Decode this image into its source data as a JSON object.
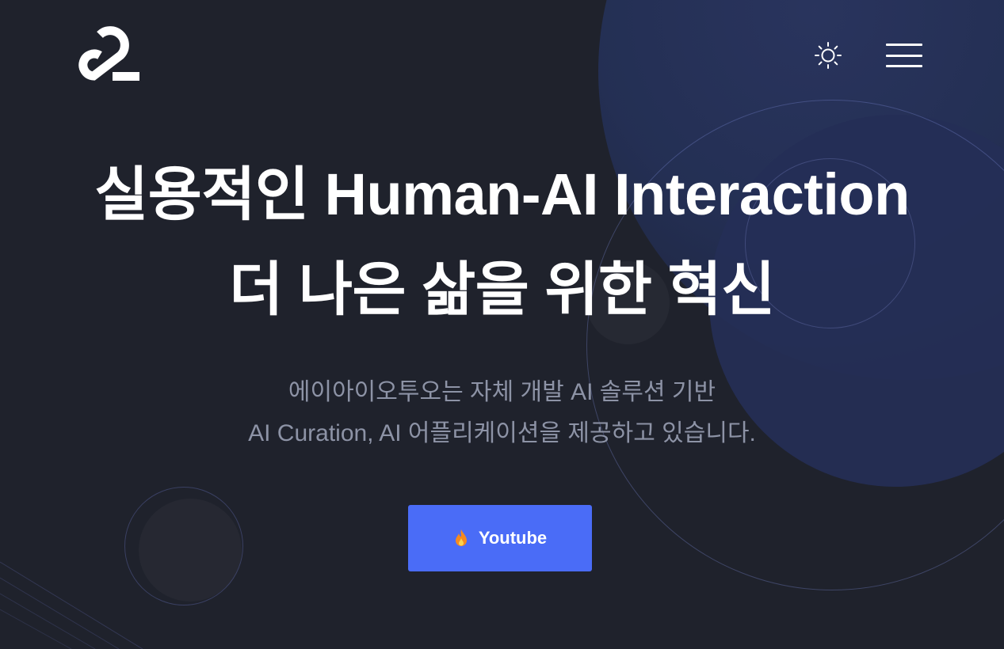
{
  "header": {
    "logo_icon": "logo-mark",
    "theme_toggle_icon": "sun-icon",
    "menu_icon": "hamburger-menu-icon"
  },
  "hero": {
    "title_line1": "실용적인 Human-AI Interaction",
    "title_line2": "더 나은 삶을 위한 혁신",
    "subtitle_line1": "에이아이오투오는 자체 개발 AI 솔루션 기반",
    "subtitle_line2": "AI Curation, AI 어플리케이션을 제공하고 있습니다.",
    "cta_label": "Youtube",
    "cta_icon": "flame-icon"
  },
  "colors": {
    "background": "#1f222c",
    "accent": "#4a6cf7",
    "subtitle": "#8d93a6",
    "flame": "#f58a1f"
  }
}
